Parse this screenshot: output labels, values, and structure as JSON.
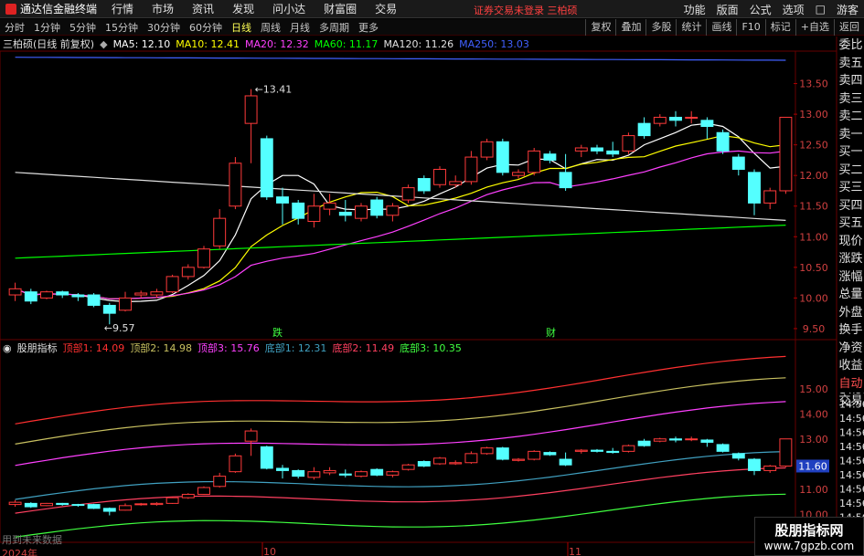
{
  "menubar": {
    "app_title": "通达信金融终端",
    "items": [
      "行情",
      "市场",
      "资讯",
      "发现",
      "问小达",
      "财富圈",
      "交易"
    ],
    "notice": "证券交易未登录  三柏硕",
    "right_items": [
      "功能",
      "版面",
      "公式",
      "选项",
      "□",
      "游客"
    ]
  },
  "periodbar": {
    "periods": [
      "分时",
      "1分钟",
      "5分钟",
      "15分钟",
      "30分钟",
      "60分钟",
      "日线",
      "周线",
      "月线",
      "多周期",
      "更多"
    ],
    "active": "日线",
    "tools": [
      "复权",
      "叠加",
      "多股",
      "统计",
      "画线",
      "F10",
      "标记",
      "+自选",
      "返回"
    ]
  },
  "ma_bar": {
    "stock": "三柏硕(日线 前复权)",
    "ma5": "MA5: 12.10",
    "ma10": "MA10: 12.41",
    "ma20": "MA20: 12.32",
    "ma60": "MA60: 11.17",
    "ma120": "MA120: 11.26",
    "ma250": "MA250: 13.03",
    "colors": {
      "ma5": "#ffffff",
      "ma10": "#ffff00",
      "ma20": "#ff40ff",
      "ma60": "#00ff00",
      "ma120": "#e0e0e0",
      "ma250": "#4060ff"
    }
  },
  "indicator_bar": {
    "name": "股朋指标",
    "top1": "顶部1: 14.09",
    "top2": "顶部2: 14.98",
    "top3": "顶部3: 15.76",
    "bot1": "底部1: 12.31",
    "bot2": "底部2: 11.49",
    "bot3": "底部3: 10.35"
  },
  "side_panel": [
    "委比",
    "卖五",
    "卖四",
    "卖三",
    "卖二",
    "卖一",
    "买一",
    "买二",
    "买三",
    "买四",
    "买五",
    "现价",
    "涨跌",
    "涨幅",
    "总量",
    "外盘",
    "换手",
    "净资",
    "收益",
    "自动",
    "交易"
  ],
  "price_axis": [
    "13.50",
    "13.00",
    "12.50",
    "12.00",
    "11.50",
    "11.00",
    "10.50",
    "10.00",
    "9.50"
  ],
  "ind_axis": [
    "15.00",
    "14.00",
    "13.00",
    "12.00",
    "11.00",
    "10.00"
  ],
  "ind_axis_time": [
    "14:56",
    "14:56",
    "14:56",
    "14:56",
    "14:56",
    "14:56",
    "14:56",
    "14:56",
    "14:56",
    "14:56",
    "14:56",
    "14:56",
    "14:56"
  ],
  "current_price_tag": "11.60",
  "high_label": "13.41",
  "low_label": "9.57",
  "event_labels": [
    "跌",
    "财"
  ],
  "x_axis": [
    "2024年",
    "10",
    "11"
  ],
  "bottom_note": "用到未来数据",
  "watermark": {
    "line1": "股朋指标网",
    "line2": "www.7gpzb.com"
  },
  "chart_data": {
    "type": "candlestick",
    "candles": [
      {
        "o": 10.05,
        "c": 10.15,
        "h": 10.25,
        "l": 9.95
      },
      {
        "o": 10.1,
        "c": 9.95,
        "h": 10.15,
        "l": 9.9
      },
      {
        "o": 10.0,
        "c": 10.1,
        "h": 10.12,
        "l": 9.98
      },
      {
        "o": 10.1,
        "c": 10.05,
        "h": 10.12,
        "l": 10.0
      },
      {
        "o": 10.05,
        "c": 10.02,
        "h": 10.08,
        "l": 9.95
      },
      {
        "o": 10.05,
        "c": 9.88,
        "h": 10.08,
        "l": 9.85
      },
      {
        "o": 9.88,
        "c": 9.75,
        "h": 9.92,
        "l": 9.57
      },
      {
        "o": 9.8,
        "c": 10.0,
        "h": 10.1,
        "l": 9.78
      },
      {
        "o": 10.05,
        "c": 10.08,
        "h": 10.12,
        "l": 10.0
      },
      {
        "o": 10.05,
        "c": 10.1,
        "h": 10.15,
        "l": 10.0
      },
      {
        "o": 10.1,
        "c": 10.35,
        "h": 10.38,
        "l": 10.08
      },
      {
        "o": 10.35,
        "c": 10.5,
        "h": 10.55,
        "l": 10.3
      },
      {
        "o": 10.5,
        "c": 10.8,
        "h": 10.85,
        "l": 10.48
      },
      {
        "o": 10.85,
        "c": 11.3,
        "h": 11.45,
        "l": 10.8
      },
      {
        "o": 11.5,
        "c": 12.2,
        "h": 12.3,
        "l": 11.45
      },
      {
        "o": 12.85,
        "c": 13.3,
        "h": 13.41,
        "l": 12.2
      },
      {
        "o": 12.6,
        "c": 11.65,
        "h": 12.65,
        "l": 11.6
      },
      {
        "o": 11.65,
        "c": 11.55,
        "h": 11.8,
        "l": 11.2
      },
      {
        "o": 11.55,
        "c": 11.3,
        "h": 11.6,
        "l": 11.2
      },
      {
        "o": 11.25,
        "c": 11.5,
        "h": 11.7,
        "l": 11.15
      },
      {
        "o": 11.45,
        "c": 11.55,
        "h": 11.7,
        "l": 11.35
      },
      {
        "o": 11.4,
        "c": 11.35,
        "h": 11.6,
        "l": 11.25
      },
      {
        "o": 11.3,
        "c": 11.5,
        "h": 11.55,
        "l": 11.25
      },
      {
        "o": 11.6,
        "c": 11.35,
        "h": 11.65,
        "l": 11.3
      },
      {
        "o": 11.35,
        "c": 11.5,
        "h": 11.55,
        "l": 11.25
      },
      {
        "o": 11.6,
        "c": 11.8,
        "h": 11.85,
        "l": 11.55
      },
      {
        "o": 11.95,
        "c": 11.75,
        "h": 12.0,
        "l": 11.7
      },
      {
        "o": 11.85,
        "c": 12.1,
        "h": 12.15,
        "l": 11.8
      },
      {
        "o": 11.85,
        "c": 11.9,
        "h": 12.0,
        "l": 11.8
      },
      {
        "o": 11.9,
        "c": 12.3,
        "h": 12.4,
        "l": 11.85
      },
      {
        "o": 12.3,
        "c": 12.55,
        "h": 12.6,
        "l": 12.25
      },
      {
        "o": 12.55,
        "c": 12.05,
        "h": 12.6,
        "l": 12.0
      },
      {
        "o": 12.0,
        "c": 12.05,
        "h": 12.1,
        "l": 11.95
      },
      {
        "o": 12.05,
        "c": 12.4,
        "h": 12.45,
        "l": 12.0
      },
      {
        "o": 12.35,
        "c": 12.25,
        "h": 12.4,
        "l": 12.2
      },
      {
        "o": 12.05,
        "c": 11.8,
        "h": 12.35,
        "l": 11.75
      },
      {
        "o": 12.4,
        "c": 12.45,
        "h": 12.5,
        "l": 12.3
      },
      {
        "o": 12.45,
        "c": 12.4,
        "h": 12.5,
        "l": 12.35
      },
      {
        "o": 12.4,
        "c": 12.35,
        "h": 12.55,
        "l": 12.3
      },
      {
        "o": 12.4,
        "c": 12.65,
        "h": 12.7,
        "l": 12.35
      },
      {
        "o": 12.85,
        "c": 12.65,
        "h": 12.95,
        "l": 12.6
      },
      {
        "o": 12.85,
        "c": 12.95,
        "h": 13.0,
        "l": 12.8
      },
      {
        "o": 12.95,
        "c": 12.9,
        "h": 13.05,
        "l": 12.8
      },
      {
        "o": 12.95,
        "c": 12.95,
        "h": 13.05,
        "l": 12.85
      },
      {
        "o": 12.9,
        "c": 12.8,
        "h": 12.95,
        "l": 12.6
      },
      {
        "o": 12.7,
        "c": 12.4,
        "h": 12.75,
        "l": 12.35
      },
      {
        "o": 12.3,
        "c": 12.1,
        "h": 12.35,
        "l": 12.0
      },
      {
        "o": 12.05,
        "c": 11.55,
        "h": 12.1,
        "l": 11.35
      },
      {
        "o": 11.55,
        "c": 11.75,
        "h": 11.8,
        "l": 11.45
      },
      {
        "o": 11.75,
        "c": 12.95,
        "h": 12.95,
        "l": 11.7
      }
    ],
    "y_range": [
      9.35,
      14.0
    ],
    "ind_range": [
      9.4,
      16.3
    ]
  }
}
